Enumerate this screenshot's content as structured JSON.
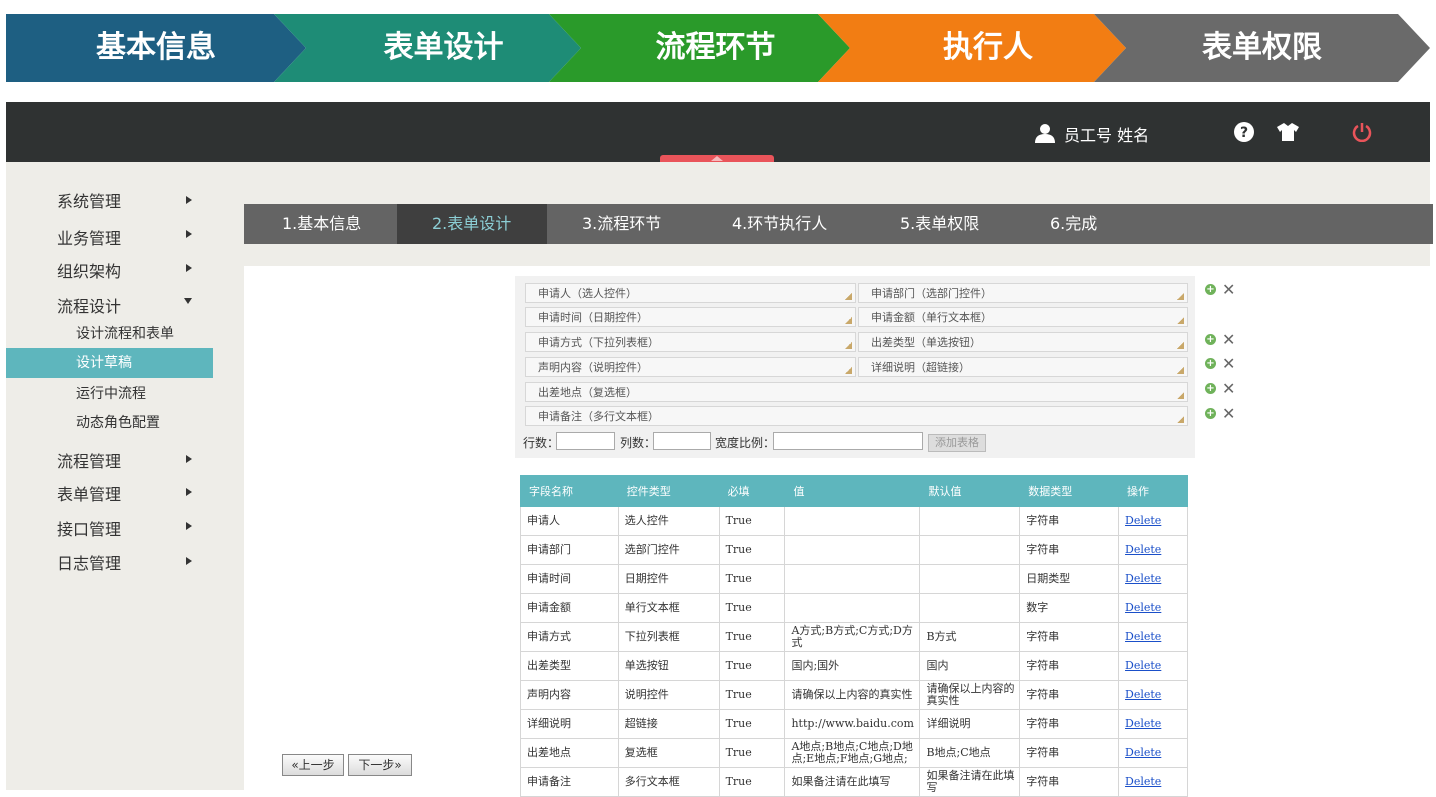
{
  "banner": {
    "steps": [
      "基本信息",
      "表单设计",
      "流程环节",
      "执行人",
      "表单权限"
    ],
    "colors": [
      "#1e5f82",
      "#1e8c76",
      "#2a9a2a",
      "#f27d13",
      "#6a6a6a"
    ]
  },
  "header": {
    "user_label": "员工号  姓名",
    "icons": [
      "user-icon",
      "help-icon",
      "shirt-icon",
      "power-icon"
    ],
    "power_color": "#e9545a"
  },
  "sidebar": {
    "items": [
      {
        "label": "系统管理",
        "expanded": false
      },
      {
        "label": "业务管理",
        "expanded": false
      },
      {
        "label": "组织架构",
        "expanded": false
      },
      {
        "label": "流程设计",
        "expanded": true
      },
      {
        "label": "流程管理",
        "expanded": false
      },
      {
        "label": "表单管理",
        "expanded": false
      },
      {
        "label": "接口管理",
        "expanded": false
      },
      {
        "label": "日志管理",
        "expanded": false
      }
    ],
    "subitems": [
      "设计流程和表单",
      "设计草稿",
      "运行中流程",
      "动态角色配置"
    ],
    "active_sub": "设计草稿",
    "accent": "#5eb6bd"
  },
  "steps": {
    "items": [
      "1.基本信息",
      "2.表单设计",
      "3.流程环节",
      "4.环节执行人",
      "5.表单权限",
      "6.完成"
    ],
    "active": "2.表单设计"
  },
  "form": {
    "fields": [
      "申请人（选人控件）",
      "申请部门（选部门控件）",
      "申请时间（日期控件）",
      "申请金额（单行文本框）",
      "申请方式（下拉列表框）",
      "出差类型（单选按钮）",
      "声明内容（说明控件）",
      "详细说明（超链接）",
      "出差地点（复选框）",
      "申请备注（多行文本框）"
    ],
    "rows_label": "行数：",
    "cols_label": "列数：",
    "width_label": "宽度比例：",
    "add_button": "添加表格"
  },
  "table": {
    "headers": [
      "字段名称",
      "控件类型",
      "必填",
      "值",
      "默认值",
      "数据类型",
      "操作"
    ],
    "rows": [
      [
        "申请人",
        "选人控件",
        "True",
        "",
        "",
        "字符串",
        "Delete"
      ],
      [
        "申请部门",
        "选部门控件",
        "True",
        "",
        "",
        "字符串",
        "Delete"
      ],
      [
        "申请时间",
        "日期控件",
        "True",
        "",
        "",
        "日期类型",
        "Delete"
      ],
      [
        "申请金额",
        "单行文本框",
        "True",
        "",
        "",
        "数字",
        "Delete"
      ],
      [
        "申请方式",
        "下拉列表框",
        "True",
        "A方式;B方式;C方式;D方式",
        "B方式",
        "字符串",
        "Delete"
      ],
      [
        "出差类型",
        "单选按钮",
        "True",
        "国内;国外",
        "国内",
        "字符串",
        "Delete"
      ],
      [
        "声明内容",
        "说明控件",
        "True",
        "请确保以上内容的真实性",
        "请确保以上内容的真实性",
        "字符串",
        "Delete"
      ],
      [
        "详细说明",
        "超链接",
        "True",
        "http://www.baidu.com",
        "详细说明",
        "字符串",
        "Delete"
      ],
      [
        "出差地点",
        "复选框",
        "True",
        "A地点;B地点;C地点;D地点;E地点;F地点;G地点;",
        "B地点;C地点",
        "字符串",
        "Delete"
      ],
      [
        "申请备注",
        "多行文本框",
        "True",
        "如果备注请在此填写",
        "如果备注请在此填写",
        "字符串",
        "Delete"
      ]
    ]
  },
  "nav": {
    "prev": "«上一步",
    "next": "下一步»"
  }
}
